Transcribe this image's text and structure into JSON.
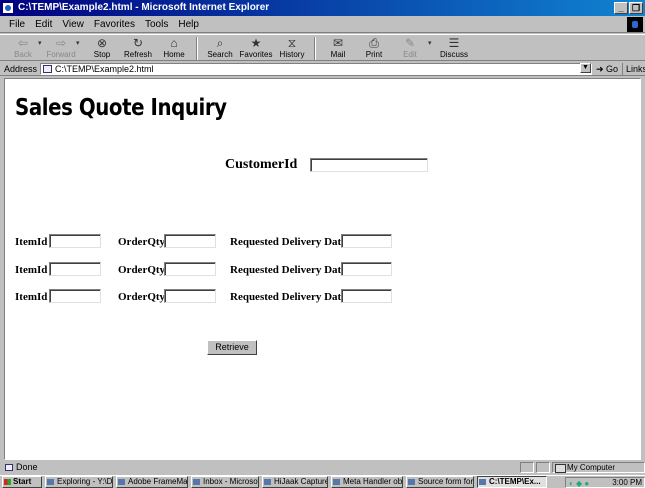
{
  "window": {
    "title": "C:\\TEMP\\Example2.html - Microsoft Internet Explorer",
    "controls": [
      "_",
      "0"
    ]
  },
  "menu": [
    "File",
    "Edit",
    "View",
    "Favorites",
    "Tools",
    "Help"
  ],
  "toolbar": [
    {
      "label": "Back",
      "icon": "⇦",
      "disabled": true
    },
    {
      "label": "Forward",
      "icon": "⇨",
      "disabled": true
    },
    {
      "label": "Stop",
      "icon": "⊗"
    },
    {
      "label": "Refresh",
      "icon": "↻"
    },
    {
      "label": "Home",
      "icon": "⌂"
    },
    {
      "label": "Search",
      "icon": "⌕"
    },
    {
      "label": "Favorites",
      "icon": "★"
    },
    {
      "label": "History",
      "icon": "⧖"
    },
    {
      "label": "Mail",
      "icon": "✉"
    },
    {
      "label": "Print",
      "icon": "⎙"
    },
    {
      "label": "Edit",
      "icon": "✎"
    },
    {
      "label": "Discuss",
      "icon": "☰"
    }
  ],
  "address": {
    "label": "Address",
    "url": "C:\\TEMP\\Example2.html",
    "go": "Go",
    "links": "Links"
  },
  "page": {
    "heading": "Sales Quote Inquiry",
    "customer_label": "CustomerId",
    "customer_value": "",
    "rows": [
      {
        "item_label": "ItemId",
        "qty_label": "OrderQty",
        "date_label": "Requested Delivery Date"
      },
      {
        "item_label": "ItemId",
        "qty_label": "OrderQty",
        "date_label": "Requested Delivery Date"
      },
      {
        "item_label": "ItemId",
        "qty_label": "OrderQty",
        "date_label": "Requested Delivery Date"
      }
    ],
    "retrieve_label": "Retrieve"
  },
  "status": {
    "text": "Done",
    "zone": "My Computer"
  },
  "taskbar": {
    "start": "Start",
    "tasks": [
      {
        "label": "Exploring - Y:\\D...",
        "active": false
      },
      {
        "label": "Adobe FrameMa...",
        "active": false
      },
      {
        "label": "Inbox - Microsoft...",
        "active": false
      },
      {
        "label": "HiJaak Capture",
        "active": false
      },
      {
        "label": "Meta Handler ob...",
        "active": false
      },
      {
        "label": "Source form for ...",
        "active": false
      },
      {
        "label": "C:\\TEMP\\Ex...",
        "active": true
      }
    ],
    "clock": "3:00 PM"
  }
}
